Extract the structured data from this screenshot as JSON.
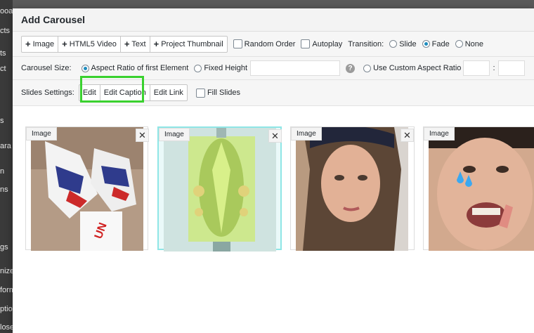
{
  "background": {
    "sidebar_fragments": [
      "ooar",
      "cts",
      "ts",
      "ct",
      "s",
      "ara",
      "n",
      "ns",
      "gs",
      "nize",
      "form",
      "ptio",
      "lose"
    ]
  },
  "modal": {
    "title": "Add Carousel"
  },
  "toolbar": {
    "add_image_label": "Image",
    "add_video_label": "HTML5 Video",
    "add_text_label": "Text",
    "add_project_label": "Project Thumbnail",
    "random_order_label": "Random Order",
    "autoplay_label": "Autoplay",
    "transition_label": "Transition:",
    "transition_options": [
      "Slide",
      "Fade",
      "None"
    ],
    "transition_selected": "Fade"
  },
  "size": {
    "label": "Carousel Size:",
    "aspect_first_label": "Aspect Ratio of first Element",
    "fixed_height_label": "Fixed Height",
    "custom_aspect_label": "Use Custom Aspect Ratio",
    "separator": ":",
    "help_glyph": "?"
  },
  "slides_settings": {
    "label": "Slides Settings:",
    "edit_label": "Edit",
    "edit_caption_label": "Edit Caption",
    "edit_link_label": "Edit Link",
    "fill_slides_label": "Fill Slides"
  },
  "slides": [
    {
      "tag": "Image",
      "close": "✕",
      "photo": "sneakers"
    },
    {
      "tag": "Image",
      "close": "✕",
      "photo": "poster"
    },
    {
      "tag": "Image",
      "close": "✕",
      "photo": "portrait-woman"
    },
    {
      "tag": "Image",
      "close": "✕",
      "photo": "face-emoji"
    }
  ],
  "colors": {
    "highlight": "#3ad12f",
    "radio_on": "#1e8cbe",
    "selected_slide_border": "#8fe6e6"
  },
  "icons": {
    "add": "plus-icon",
    "close": "close-icon",
    "help": "help-icon"
  }
}
